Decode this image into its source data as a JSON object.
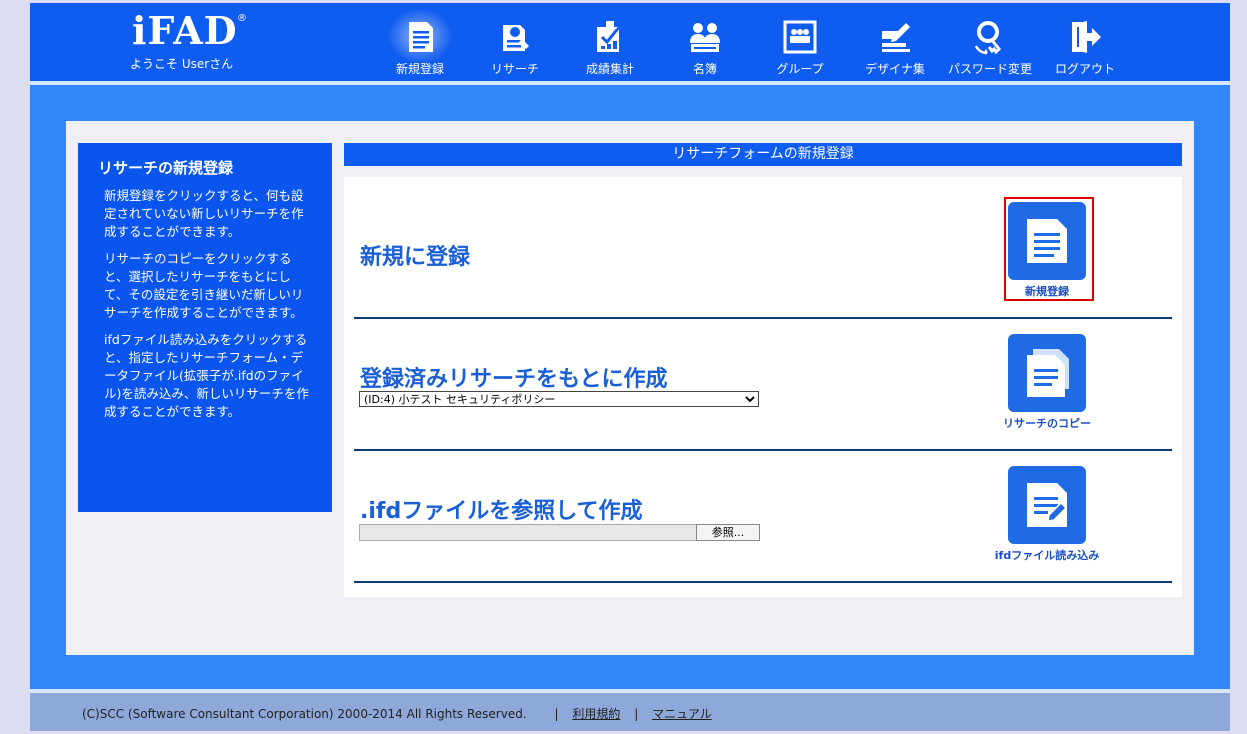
{
  "header": {
    "logo": "iFAD",
    "logo_reg": "®",
    "welcome": "ようこそ Userさん",
    "nav": [
      {
        "label": "新規登録",
        "icon": "document-icon",
        "active": true
      },
      {
        "label": "リサーチ",
        "icon": "research-icon"
      },
      {
        "label": "成績集計",
        "icon": "tally-icon"
      },
      {
        "label": "名簿",
        "icon": "users-icon"
      },
      {
        "label": "グループ",
        "icon": "group-icon"
      },
      {
        "label": "デザイナ集",
        "icon": "designer-icon"
      },
      {
        "label": "パスワード変更",
        "icon": "key-icon"
      },
      {
        "label": "ログアウト",
        "icon": "logout-icon"
      }
    ]
  },
  "sidebar": {
    "title": "リサーチの新規登録",
    "paragraphs": [
      "新規登録をクリックすると、何も設定されていない新しいリサーチを作成することができます。",
      "リサーチのコピーをクリックすると、選択したリサーチをもとにして、その設定を引き継いだ新しいリサーチを作成することができます。",
      "ifdファイル読み込みをクリックすると、指定したリサーチフォーム・データファイル(拡張子が.ifdのファイル)を読み込み、新しいリサーチを作成することができます。"
    ]
  },
  "main": {
    "title": "リサーチフォームの新規登録",
    "sections": [
      {
        "heading": "新規に登録",
        "button_label": "新規登録",
        "icon": "new-document-icon"
      },
      {
        "heading": "登録済みリサーチをもとに作成",
        "button_label": "リサーチのコピー",
        "icon": "copy-document-icon",
        "select_value": "(ID:4) 小テスト セキュリティポリシー"
      },
      {
        "heading": ".ifdファイルを参照して作成",
        "button_label": "ifdファイル読み込み",
        "icon": "import-document-icon",
        "file_button": "参照..."
      }
    ]
  },
  "footer": {
    "copyright": "(C)SCC (Software Consultant Corporation) 2000-2014 All Rights Reserved.",
    "links": [
      "利用規約",
      "マニュアル"
    ],
    "separator": "|"
  },
  "colors": {
    "header_blue": "#0f5cf0",
    "area_blue": "#3386fa",
    "button_blue": "#1f6be5",
    "highlight_red": "#e00000"
  }
}
